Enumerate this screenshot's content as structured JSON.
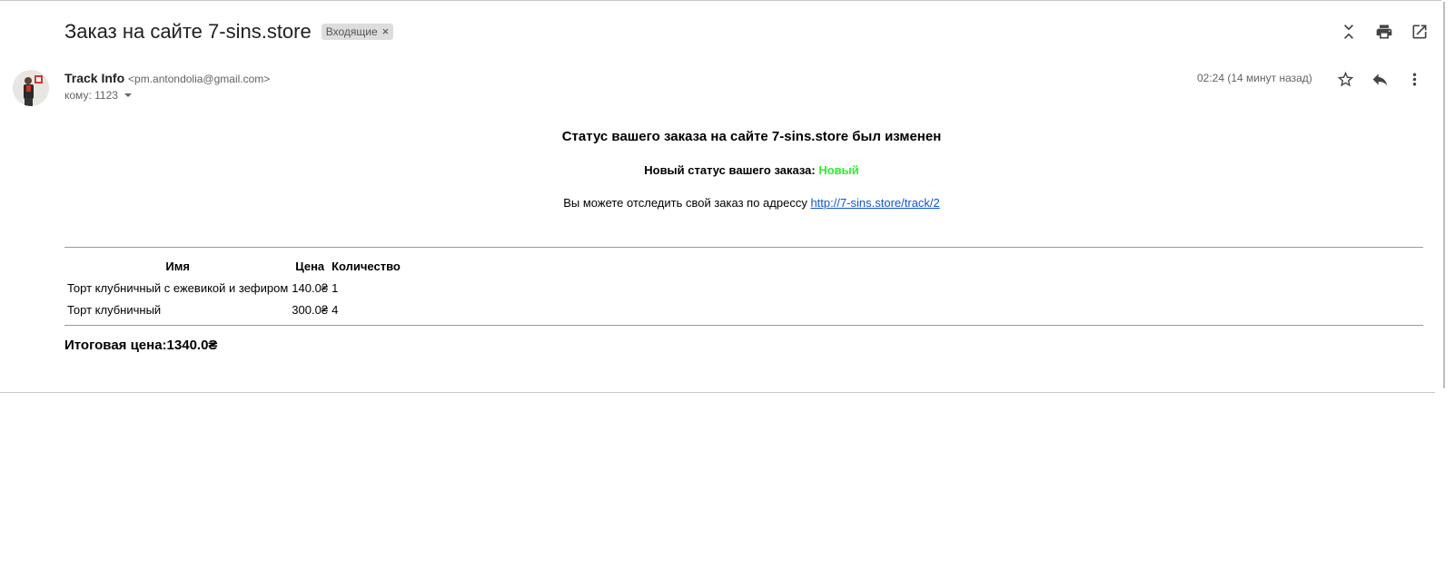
{
  "subject": "Заказ на сайте 7-sins.store",
  "label_chip": {
    "text": "Входящие",
    "remove": "×"
  },
  "toolbar_icons": [
    "expand-all-icon",
    "print-icon",
    "open-new-window-icon"
  ],
  "sender": {
    "name": "Track Info",
    "email": "<pm.antondolia@gmail.com>"
  },
  "recipient": {
    "text": "кому: 1123"
  },
  "timestamp": "02:24 (14 минут назад)",
  "message_icons": [
    "star-icon",
    "reply-icon",
    "more-vert-icon"
  ],
  "body": {
    "title": "Статус вашего заказа на сайте 7-sins.store был изменен",
    "status_prefix": "Новый статус вашего заказа: ",
    "status_value": "Новый",
    "status_color": "#33ee33",
    "track_prefix": "Вы можете отследить свой заказ по адрессу ",
    "track_link": "http://7-sins.store/track/2"
  },
  "table": {
    "headers": [
      "Имя",
      "Цена",
      "Количество"
    ],
    "rows": [
      [
        "Торт клубничный с ежевикой и зефиром",
        "140.0₴",
        "1"
      ],
      [
        "Торт клубничный",
        "300.0₴",
        "4"
      ]
    ]
  },
  "total": "Итоговая цена:1340.0₴"
}
